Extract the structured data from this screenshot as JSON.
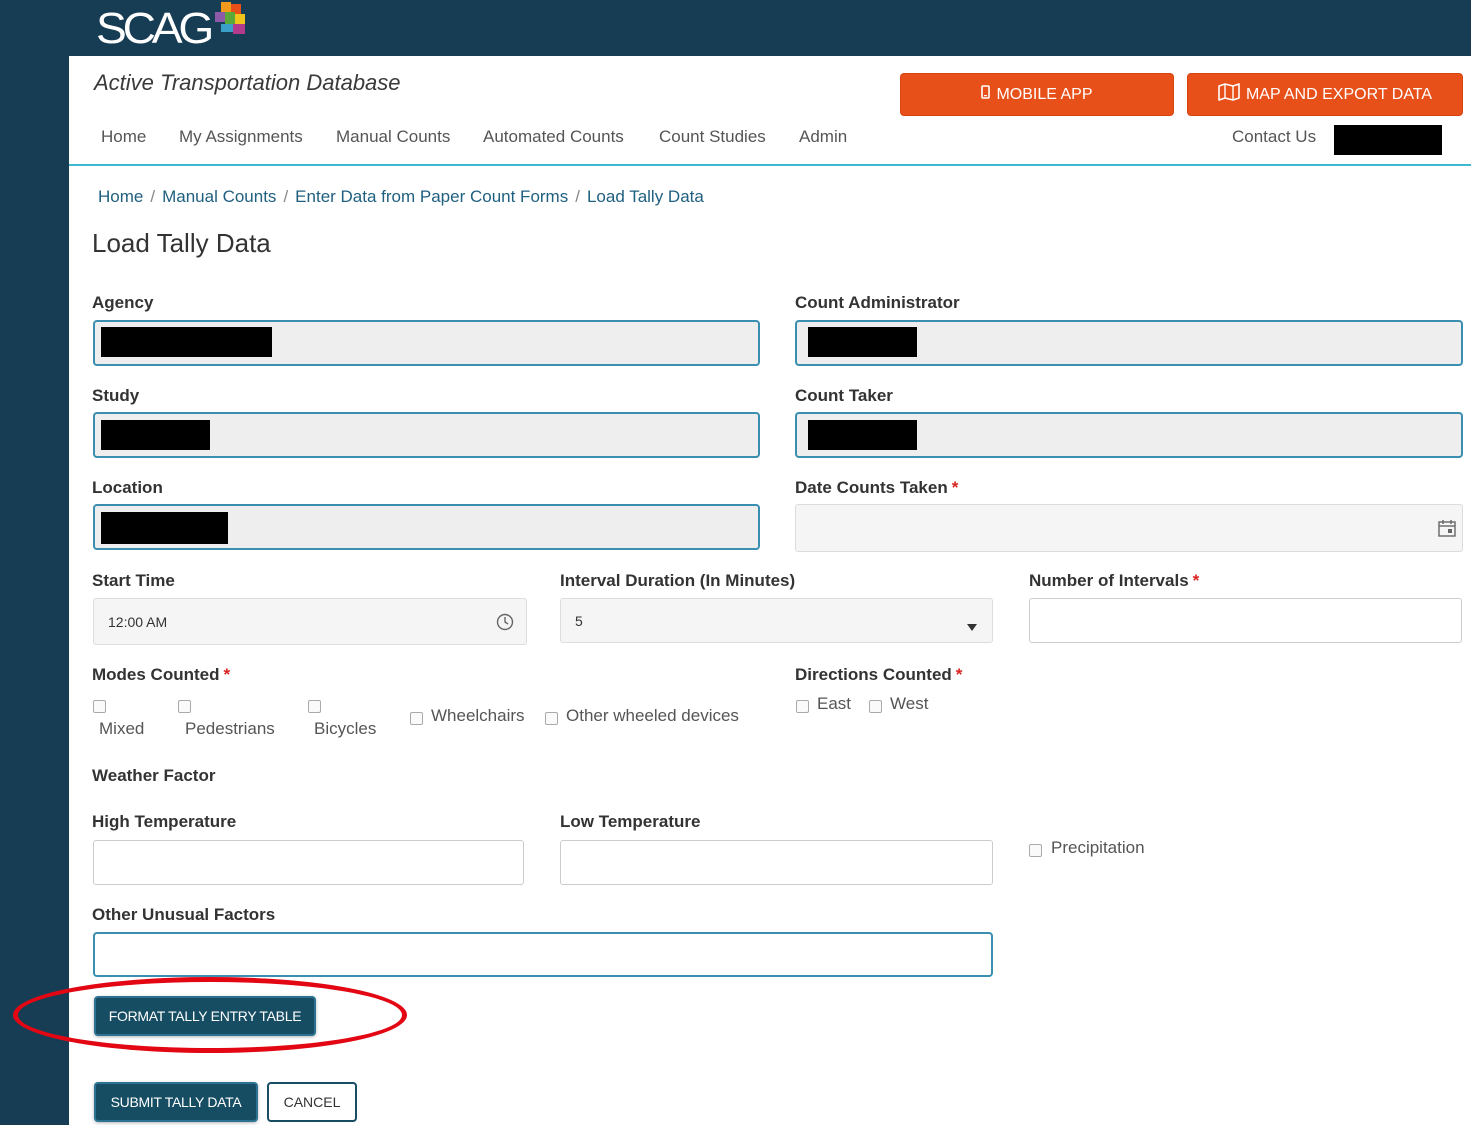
{
  "logo": {
    "text": "SCAG"
  },
  "header": {
    "app_title": "Active Transportation Database",
    "mobile_app_label": "MOBILE APP",
    "map_export_label": "MAP AND EXPORT DATA"
  },
  "nav": {
    "items": [
      "Home",
      "My Assignments",
      "Manual Counts",
      "Automated Counts",
      "Count Studies",
      "Admin"
    ],
    "contact_label": "Contact Us"
  },
  "breadcrumb": [
    "Home",
    "Manual Counts",
    "Enter Data from Paper Count Forms",
    "Load Tally Data"
  ],
  "page_title": "Load Tally Data",
  "form": {
    "agency_label": "Agency",
    "count_admin_label": "Count Administrator",
    "study_label": "Study",
    "count_taker_label": "Count Taker",
    "location_label": "Location",
    "date_label": "Date Counts Taken",
    "start_time_label": "Start Time",
    "start_time_value": "12:00 AM",
    "interval_label": "Interval Duration (In Minutes)",
    "interval_value": "5",
    "num_intervals_label": "Number of Intervals",
    "modes_label": "Modes Counted",
    "modes": [
      "Mixed",
      "Pedestrians",
      "Bicycles",
      "Wheelchairs",
      "Other wheeled devices"
    ],
    "directions_label": "Directions Counted",
    "directions": [
      "East",
      "West"
    ],
    "weather_label": "Weather Factor",
    "high_temp_label": "High Temperature",
    "low_temp_label": "Low Temperature",
    "precip_label": "Precipitation",
    "other_factors_label": "Other Unusual Factors",
    "required_mark": "*"
  },
  "actions": {
    "format_label": "FORMAT TALLY ENTRY TABLE",
    "submit_label": "SUBMIT TALLY DATA",
    "cancel_label": "CANCEL"
  },
  "colors": {
    "header_bg": "#173d55",
    "accent_orange": "#e8501a",
    "button_dark": "#174d63",
    "nav_underline": "#3db9d3",
    "highlight_red": "#e30613"
  }
}
